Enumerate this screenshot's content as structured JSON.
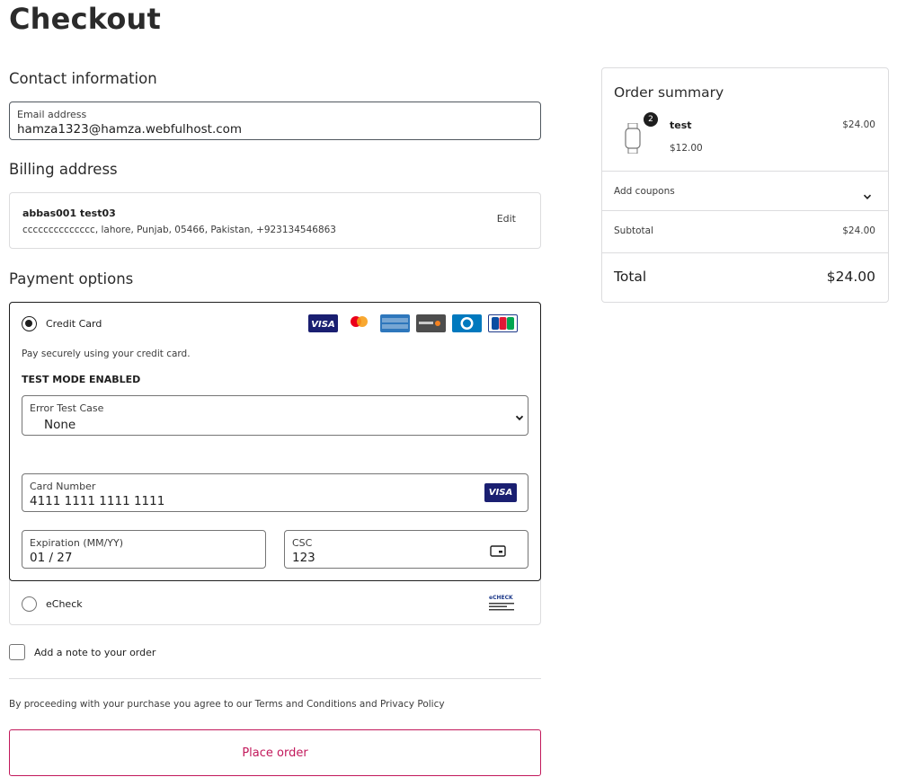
{
  "page": {
    "title": "Checkout"
  },
  "contact": {
    "heading": "Contact information",
    "email_label": "Email address",
    "email_value": "hamza1323@hamza.webfulhost.com"
  },
  "billing": {
    "heading": "Billing address",
    "name": "abbas001 test03",
    "address": "cccccccccccccc, lahore, Punjab, 05466, Pakistan, +923134546863",
    "edit_label": "Edit"
  },
  "payment": {
    "heading": "Payment options",
    "credit_card": {
      "label": "Credit Card",
      "selected": true,
      "description": "Pay securely using your credit card.",
      "test_mode": "TEST MODE ENABLED",
      "error_case_label": "Error Test Case",
      "error_case_value": "None",
      "card_number_label": "Card Number",
      "card_number_value": "4111 1111 1111 1111",
      "expiration_label": "Expiration (MM/YY)",
      "expiration_value": "01 / 27",
      "csc_label": "CSC",
      "csc_value": "123",
      "visa_text": "VISA",
      "echeck_text": "eCHECK"
    },
    "echeck": {
      "label": "eCheck",
      "selected": false
    }
  },
  "note": {
    "label": "Add a note to your order",
    "checked": false
  },
  "terms": {
    "text": "By proceeding with your purchase you agree to our Terms and Conditions and Privacy Policy"
  },
  "place_order": {
    "label": "Place order"
  },
  "summary": {
    "title": "Order summary",
    "item": {
      "name": "test",
      "quantity": "2",
      "unit_price": "$12.00",
      "line_total": "$24.00"
    },
    "coupons_label": "Add coupons",
    "subtotal_label": "Subtotal",
    "subtotal_value": "$24.00",
    "total_label": "Total",
    "total_value": "$24.00"
  },
  "colors": {
    "accent": "#c2185b",
    "border": "#dcdcde",
    "text": "#1e1e1e"
  },
  "icons": [
    "chevron-down-icon",
    "watch-icon",
    "card-back-icon",
    "visa-logo",
    "mastercard-logo",
    "amex-logo",
    "discover-logo",
    "diners-logo",
    "jcb-logo",
    "echeck-logo"
  ]
}
